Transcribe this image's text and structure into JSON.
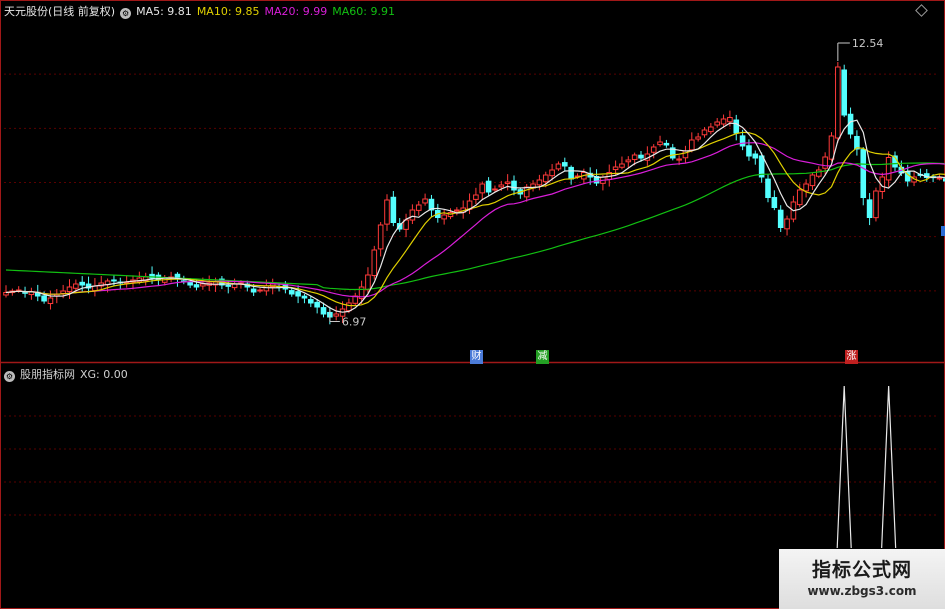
{
  "main_header": {
    "title": "天元股份(日线 前复权)",
    "ma5": "MA5: 9.81",
    "ma10": "MA10: 9.85",
    "ma20": "MA20: 9.99",
    "ma60": "MA60: 9.91"
  },
  "colors": {
    "up": "#ff3a3a",
    "down": "#54ffff",
    "ma5": "#e8e8e8",
    "ma10": "#e0d000",
    "ma20": "#d91ed9",
    "ma60": "#12c012",
    "grid": "#5a0000",
    "frame": "#a01818"
  },
  "price_annotations": {
    "high": "12.54",
    "low": "6.97"
  },
  "markers": [
    {
      "label": "财",
      "color": "#4b7bd8"
    },
    {
      "label": "减",
      "color": "#24a024"
    },
    {
      "label": "涨",
      "color": "#c02020"
    }
  ],
  "sub_header": {
    "title": "股朋指标网",
    "xg": "XG: 0.00"
  },
  "watermark": {
    "line1": "指标公式网",
    "line2": "www.zbgs3.com"
  },
  "chart_data": [
    {
      "type": "candlestick",
      "title": "天元股份(日线 前复权)",
      "y_range": [
        6.5,
        13.0
      ],
      "closes": [
        7.55,
        7.58,
        7.6,
        7.54,
        7.56,
        7.48,
        7.38,
        7.44,
        7.52,
        7.58,
        7.66,
        7.72,
        7.7,
        7.64,
        7.68,
        7.74,
        7.78,
        7.8,
        7.74,
        7.76,
        7.8,
        7.84,
        7.86,
        7.84,
        7.8,
        7.84,
        7.86,
        7.82,
        7.76,
        7.7,
        7.66,
        7.72,
        7.74,
        7.76,
        7.7,
        7.68,
        7.72,
        7.74,
        7.66,
        7.56,
        7.6,
        7.68,
        7.72,
        7.66,
        7.62,
        7.52,
        7.48,
        7.44,
        7.34,
        7.26,
        7.12,
        7.06,
        7.12,
        7.22,
        7.34,
        7.48,
        7.66,
        7.9,
        8.4,
        8.9,
        9.4,
        8.95,
        8.82,
        9.0,
        9.2,
        9.3,
        9.42,
        9.2,
        9.05,
        9.1,
        9.15,
        9.2,
        9.24,
        9.38,
        9.5,
        9.72,
        9.56,
        9.62,
        9.7,
        9.76,
        9.6,
        9.52,
        9.66,
        9.72,
        9.8,
        9.9,
        10.0,
        10.12,
        10.08,
        9.82,
        9.88,
        9.95,
        9.86,
        9.74,
        9.86,
        9.95,
        10.06,
        10.12,
        10.2,
        10.3,
        10.24,
        10.32,
        10.46,
        10.56,
        10.5,
        10.24,
        10.22,
        10.38,
        10.6,
        10.66,
        10.8,
        10.86,
        10.96,
        11.02,
        11.05,
        10.74,
        10.48,
        10.28,
        10.24,
        9.86,
        9.45,
        9.25,
        8.85,
        9.02,
        9.36,
        9.6,
        9.72,
        9.9,
        10.0,
        10.26,
        10.68,
        12.06,
        11.1,
        10.72,
        10.42,
        9.45,
        9.05,
        9.58,
        9.86,
        10.25,
        10.06,
        9.94,
        9.78,
        9.86,
        9.9,
        9.85,
        9.86,
        9.84,
        9.78,
        9.81
      ],
      "ma5_last": 9.81,
      "ma10_last": 9.85,
      "ma20_last": 9.99,
      "ma60_last": 9.91,
      "annotations": {
        "high": 12.54,
        "low": 6.97
      }
    },
    {
      "type": "line",
      "title": "股朋指标网",
      "series": [
        {
          "name": "XG",
          "last": 0.0
        }
      ],
      "y_range": [
        0,
        1
      ],
      "spikes_at_index": [
        132,
        139
      ]
    }
  ]
}
